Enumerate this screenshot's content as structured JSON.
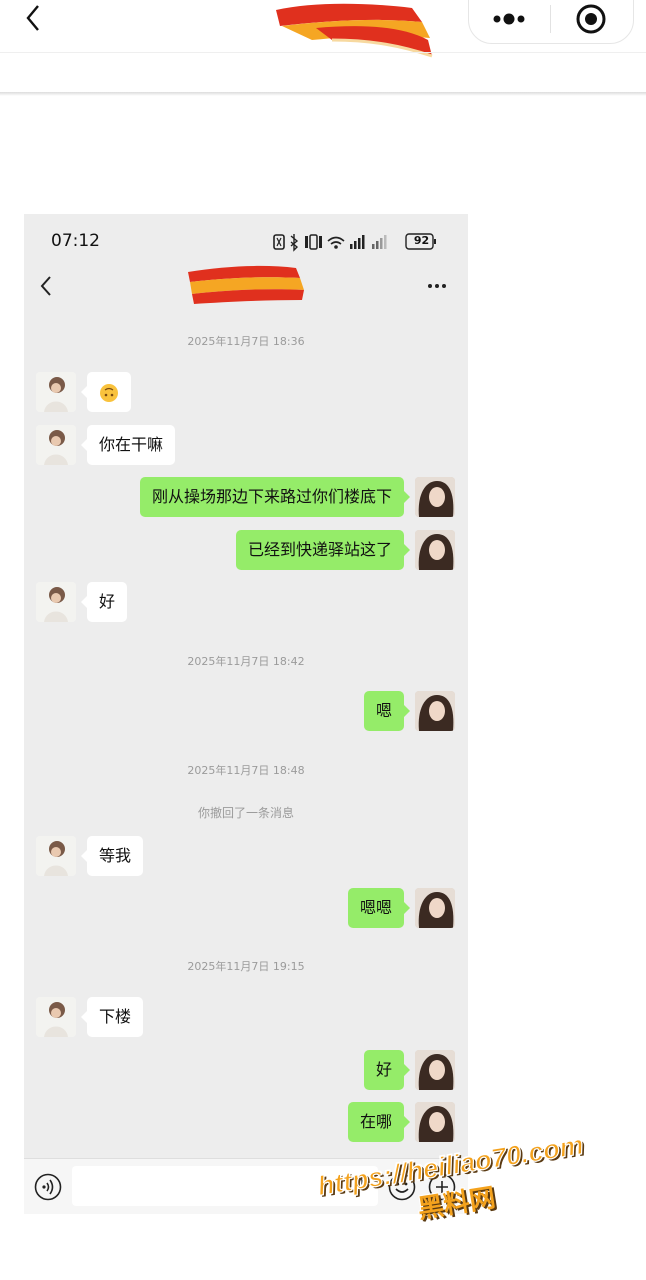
{
  "outer": {
    "back_icon": "chevron-left-icon",
    "more_icon": "more-dots-icon",
    "close_icon": "target-circle-icon"
  },
  "status_bar": {
    "time": "07:12",
    "battery": "92"
  },
  "chat": {
    "back_icon": "chevron-left-icon",
    "more_icon": "more-dots-icon",
    "messages": [
      {
        "type": "time",
        "text": "2025年11月7日 18:36"
      },
      {
        "type": "in",
        "text": "🙃"
      },
      {
        "type": "in",
        "text": "你在干嘛"
      },
      {
        "type": "out",
        "text": "刚从操场那边下来路过你们楼底下"
      },
      {
        "type": "out",
        "text": "已经到快递驿站这了"
      },
      {
        "type": "in",
        "text": "好"
      },
      {
        "type": "time",
        "text": "2025年11月7日 18:42"
      },
      {
        "type": "out",
        "text": "嗯"
      },
      {
        "type": "time",
        "text": "2025年11月7日 18:48"
      },
      {
        "type": "system",
        "text": "你撤回了一条消息"
      },
      {
        "type": "in",
        "text": "等我"
      },
      {
        "type": "out",
        "text": "嗯嗯"
      },
      {
        "type": "time",
        "text": "2025年11月7日 19:15"
      },
      {
        "type": "in",
        "text": "下楼"
      },
      {
        "type": "out",
        "text": "好"
      },
      {
        "type": "out",
        "text": "在哪"
      }
    ]
  },
  "input_bar": {
    "value": "",
    "voice_icon": "voice-icon",
    "mic_icon": "mic-icon",
    "emoji_icon": "emoji-icon",
    "plus_icon": "plus-icon"
  },
  "watermark": {
    "url": "https://heiliao70.com",
    "name": "黑料网"
  },
  "colors": {
    "chat_bg": "#ededed",
    "out_bubble": "#95ec69",
    "in_bubble": "#ffffff",
    "watermark": "#f4a21d",
    "scribble_red": "#e0301e",
    "scribble_orange": "#f5a623"
  }
}
